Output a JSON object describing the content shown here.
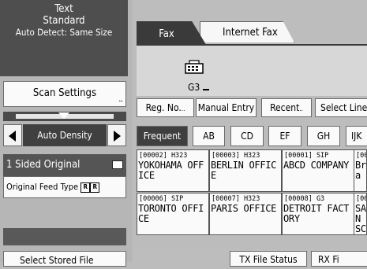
{
  "left": {
    "scan_line1": "Text",
    "scan_line2": "Standard",
    "scan_line3": "Auto Detect: Same Size",
    "scan_settings": "Scan Settings",
    "density_label": "Auto Density",
    "sided": "1 Sided Original",
    "feed_type": "Original Feed Type",
    "feed_icon1": "R",
    "feed_icon2": "R",
    "stored_file": "Select Stored File"
  },
  "tabs": {
    "fax": "Fax",
    "internet_fax": "Internet Fax"
  },
  "destination": {
    "mode": "G3",
    "value": ""
  },
  "buttons": {
    "reg_no": "Reg. No.",
    "manual_entry": "Manual Entry",
    "recent": "Recent",
    "select_line": "Select Line"
  },
  "index_tabs": [
    "Frequent",
    "AB",
    "CD",
    "EF",
    "GH",
    "IJK"
  ],
  "entries": [
    {
      "id": "[00002] H323",
      "name": "YOKOHAMA OFFICE"
    },
    {
      "id": "[00003] H323",
      "name": "BERLIN OFFICE"
    },
    {
      "id": "[00001] SIP",
      "name": "ABCD COMPANY"
    },
    {
      "id": "[000",
      "name": "Bra"
    },
    {
      "id": "[00006] SIP",
      "name": "TORONTO OFFICE"
    },
    {
      "id": "[00007] H323",
      "name": "PARIS OFFICE"
    },
    {
      "id": "[00008] G3",
      "name": "DETROIT FACTORY"
    },
    {
      "id": "[000",
      "name": "SAN SCO"
    }
  ],
  "bottom": {
    "tx_status": "TX File Status",
    "rx_file": "RX Fi"
  },
  "colors": {
    "dark_panel": "#4e4e4e",
    "active_tab": "#3f3f3f",
    "background": "#bcbcbc"
  }
}
